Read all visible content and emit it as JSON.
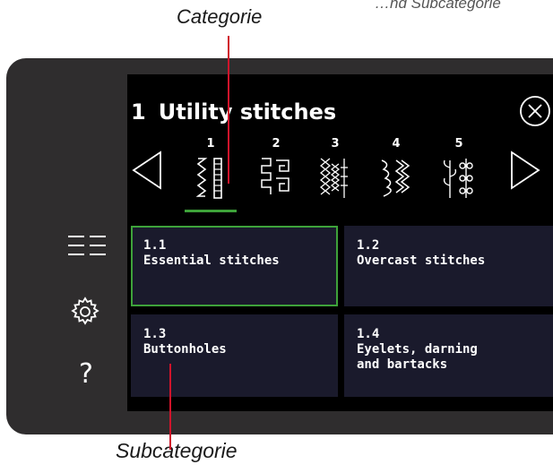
{
  "annotations": {
    "category": "Categorie",
    "subcategory": "Subcategorie",
    "cut_top_text": "…nd Subcategorie"
  },
  "header": {
    "menu_number": "1",
    "title": "Utility stitches"
  },
  "icons": {
    "close": "close-circle-icon",
    "previous": "triangle-left-icon",
    "next": "triangle-right-icon",
    "menu": "menu-list-icon",
    "settings": "gear-icon",
    "help": "question-mark-icon"
  },
  "sidebar": {
    "help_label": "?"
  },
  "categories": [
    {
      "number": "1",
      "icon": "straight-stitch-icon",
      "selected": true
    },
    {
      "number": "2",
      "icon": "overcast-stitch-icon",
      "selected": false
    },
    {
      "number": "3",
      "icon": "buttonhole-stitch-icon",
      "selected": false
    },
    {
      "number": "4",
      "icon": "eyelet-stitch-icon",
      "selected": false
    },
    {
      "number": "5",
      "icon": "decorative-stitch-icon",
      "selected": false
    }
  ],
  "subcategories": [
    {
      "number": "1.1",
      "label": "Essential stitches",
      "selected": true
    },
    {
      "number": "1.2",
      "label": "Overcast stitches",
      "selected": false
    },
    {
      "number": "1.3",
      "label": "Buttonholes",
      "selected": false
    },
    {
      "number": "1.4",
      "label": "Eyelets, darning\nand bartacks",
      "selected": false
    }
  ],
  "colors": {
    "accent": "#3ea23a",
    "leader": "#d0142b",
    "tile": "#1a1a2c",
    "frame": "#2f2d2e"
  }
}
